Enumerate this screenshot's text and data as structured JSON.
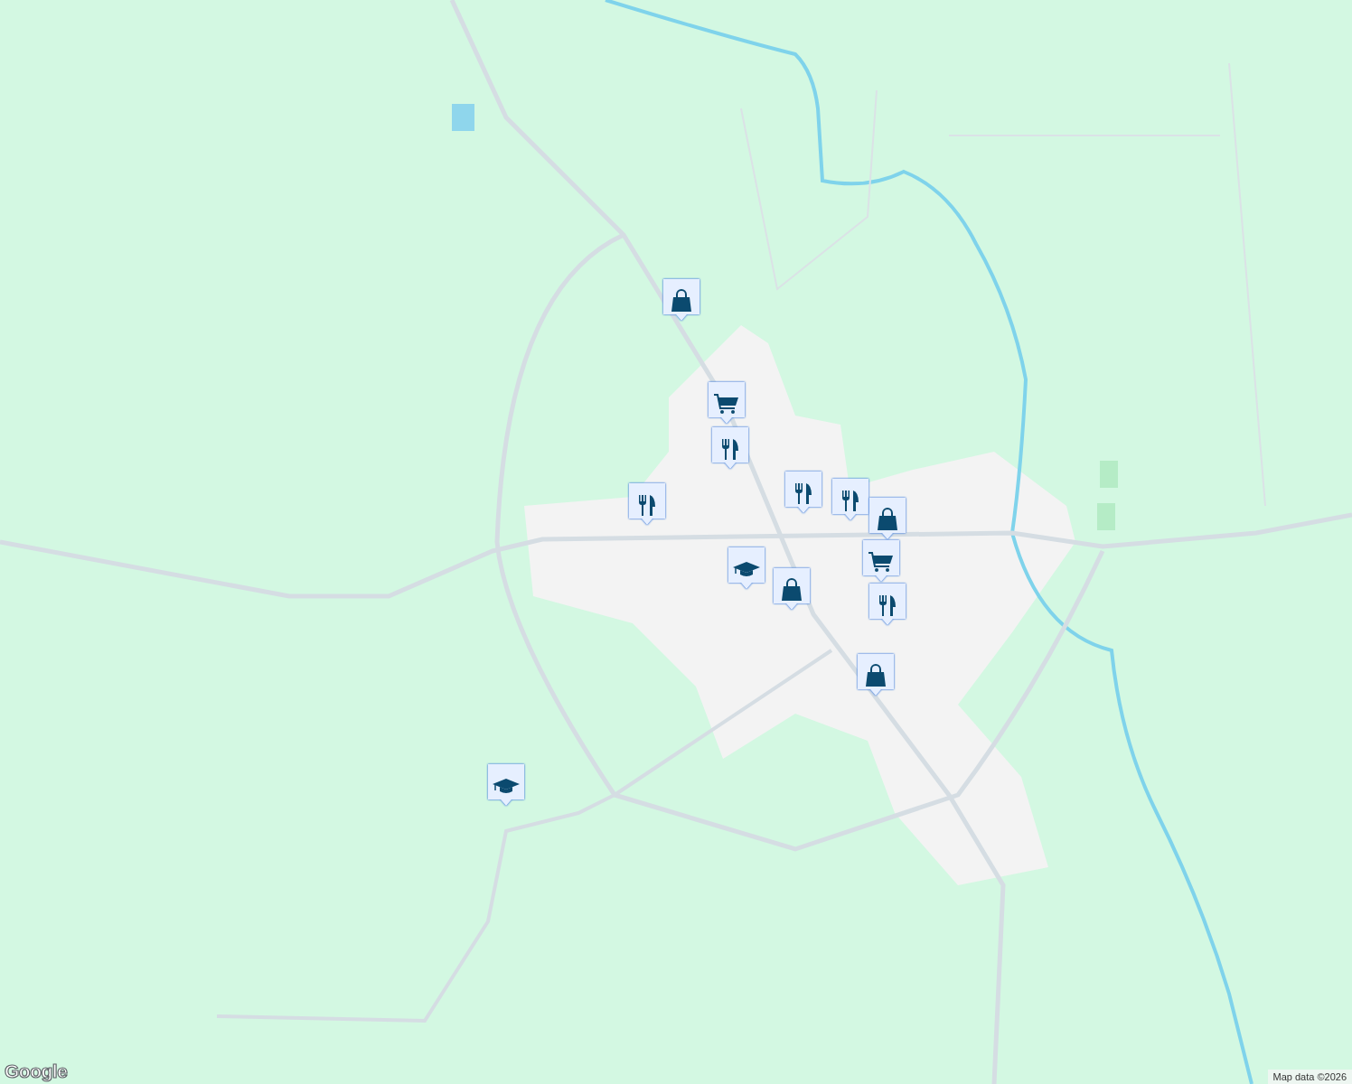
{
  "map": {
    "kind": "picture",
    "markers": [
      {
        "kind": "shopping"
      },
      {
        "kind": "grocery"
      },
      {
        "kind": "restaurant"
      },
      {
        "kind": "restaurant"
      },
      {
        "kind": "restaurant"
      },
      {
        "kind": "restaurant"
      },
      {
        "kind": "shopping"
      },
      {
        "kind": "school"
      },
      {
        "kind": "shopping"
      },
      {
        "kind": "grocery"
      },
      {
        "kind": "restaurant"
      },
      {
        "kind": "shopping"
      },
      {
        "kind": "school"
      }
    ]
  },
  "logo": "Google",
  "attribution": "Map data ©2026"
}
